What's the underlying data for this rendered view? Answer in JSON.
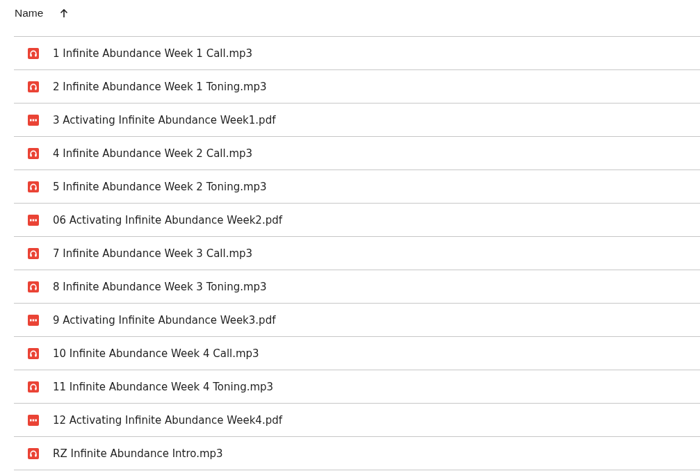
{
  "table": {
    "columns": [
      {
        "label": "Name",
        "sorted_ascending": true
      }
    ],
    "rows": [
      {
        "kind": "audio",
        "name": "1 Infinite Abundance Week 1 Call.mp3"
      },
      {
        "kind": "audio",
        "name": "2 Infinite Abundance Week 1 Toning.mp3"
      },
      {
        "kind": "pdf",
        "name": "3 Activating Infinite Abundance Week1.pdf"
      },
      {
        "kind": "audio",
        "name": "4 Infinite Abundance Week 2 Call.mp3"
      },
      {
        "kind": "audio",
        "name": "5 Infinite Abundance Week 2 Toning.mp3"
      },
      {
        "kind": "pdf",
        "name": "06 Activating Infinite Abundance Week2.pdf"
      },
      {
        "kind": "audio",
        "name": "7 Infinite Abundance Week 3 Call.mp3"
      },
      {
        "kind": "audio",
        "name": "8 Infinite Abundance Week 3 Toning.mp3"
      },
      {
        "kind": "pdf",
        "name": "9 Activating Infinite Abundance Week3.pdf"
      },
      {
        "kind": "audio",
        "name": "10 Infinite Abundance Week 4 Call.mp3"
      },
      {
        "kind": "audio",
        "name": "11 Infinite Abundance Week 4 Toning.mp3"
      },
      {
        "kind": "pdf",
        "name": "12 Activating Infinite Abundance Week4.pdf"
      },
      {
        "kind": "audio",
        "name": "RZ Infinite Abundance Intro.mp3"
      }
    ]
  }
}
